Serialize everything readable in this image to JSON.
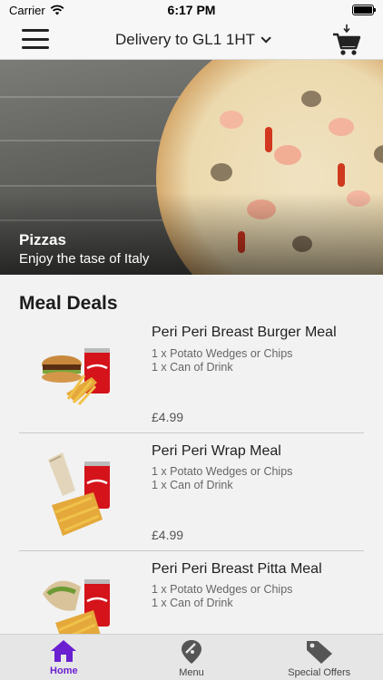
{
  "status_bar": {
    "carrier": "Carrier",
    "time": "6:17 PM"
  },
  "navbar": {
    "delivery_label": "Delivery to GL1 1HT",
    "icons": [
      "menu-icon",
      "chevron-down-icon",
      "cart-icon"
    ]
  },
  "hero": {
    "title": "Pizzas",
    "subtitle": "Enjoy the tase of Italy"
  },
  "section": {
    "title": "Meal Deals"
  },
  "deals": [
    {
      "name": "Peri Peri Breast Burger Meal",
      "line1": "1 x Potato Wedges or Chips",
      "line2": "1 x Can of Drink",
      "price": "£4.99"
    },
    {
      "name": "Peri Peri Wrap Meal",
      "line1": "1 x Potato Wedges or Chips",
      "line2": "1 x Can of Drink",
      "price": "£4.99"
    },
    {
      "name": "Peri Peri Breast Pitta Meal",
      "line1": "1 x Potato Wedges or Chips",
      "line2": "1 x Can of Drink",
      "price": ""
    }
  ],
  "tabs": [
    {
      "label": "Home",
      "icon": "home-icon",
      "active": true
    },
    {
      "label": "Menu",
      "icon": "location-pin-icon",
      "active": false
    },
    {
      "label": "Special Offers",
      "icon": "tag-icon",
      "active": false
    }
  ],
  "colors": {
    "accent": "#6a1fd0",
    "tabbar_bg": "#e6e6e6",
    "page_bg": "#f2f2f2"
  }
}
